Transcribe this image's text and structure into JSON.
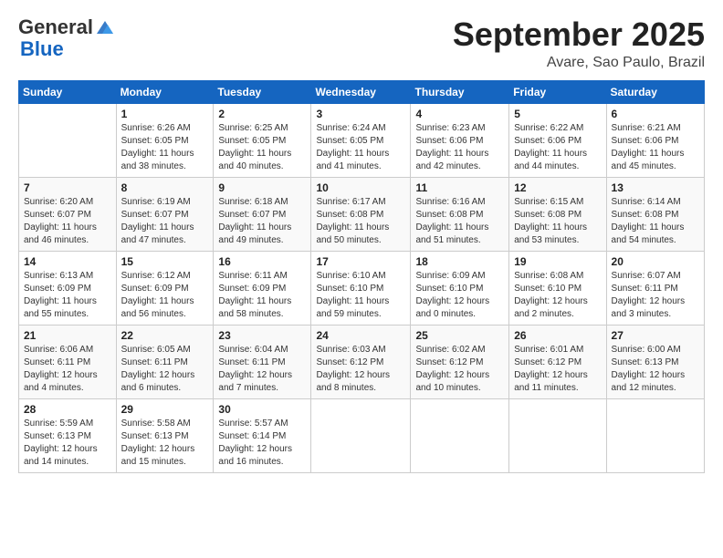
{
  "logo": {
    "general": "General",
    "blue": "Blue"
  },
  "header": {
    "month": "September 2025",
    "location": "Avare, Sao Paulo, Brazil"
  },
  "weekdays": [
    "Sunday",
    "Monday",
    "Tuesday",
    "Wednesday",
    "Thursday",
    "Friday",
    "Saturday"
  ],
  "weeks": [
    [
      {
        "day": "",
        "info": ""
      },
      {
        "day": "1",
        "info": "Sunrise: 6:26 AM\nSunset: 6:05 PM\nDaylight: 11 hours\nand 38 minutes."
      },
      {
        "day": "2",
        "info": "Sunrise: 6:25 AM\nSunset: 6:05 PM\nDaylight: 11 hours\nand 40 minutes."
      },
      {
        "day": "3",
        "info": "Sunrise: 6:24 AM\nSunset: 6:05 PM\nDaylight: 11 hours\nand 41 minutes."
      },
      {
        "day": "4",
        "info": "Sunrise: 6:23 AM\nSunset: 6:06 PM\nDaylight: 11 hours\nand 42 minutes."
      },
      {
        "day": "5",
        "info": "Sunrise: 6:22 AM\nSunset: 6:06 PM\nDaylight: 11 hours\nand 44 minutes."
      },
      {
        "day": "6",
        "info": "Sunrise: 6:21 AM\nSunset: 6:06 PM\nDaylight: 11 hours\nand 45 minutes."
      }
    ],
    [
      {
        "day": "7",
        "info": "Sunrise: 6:20 AM\nSunset: 6:07 PM\nDaylight: 11 hours\nand 46 minutes."
      },
      {
        "day": "8",
        "info": "Sunrise: 6:19 AM\nSunset: 6:07 PM\nDaylight: 11 hours\nand 47 minutes."
      },
      {
        "day": "9",
        "info": "Sunrise: 6:18 AM\nSunset: 6:07 PM\nDaylight: 11 hours\nand 49 minutes."
      },
      {
        "day": "10",
        "info": "Sunrise: 6:17 AM\nSunset: 6:08 PM\nDaylight: 11 hours\nand 50 minutes."
      },
      {
        "day": "11",
        "info": "Sunrise: 6:16 AM\nSunset: 6:08 PM\nDaylight: 11 hours\nand 51 minutes."
      },
      {
        "day": "12",
        "info": "Sunrise: 6:15 AM\nSunset: 6:08 PM\nDaylight: 11 hours\nand 53 minutes."
      },
      {
        "day": "13",
        "info": "Sunrise: 6:14 AM\nSunset: 6:08 PM\nDaylight: 11 hours\nand 54 minutes."
      }
    ],
    [
      {
        "day": "14",
        "info": "Sunrise: 6:13 AM\nSunset: 6:09 PM\nDaylight: 11 hours\nand 55 minutes."
      },
      {
        "day": "15",
        "info": "Sunrise: 6:12 AM\nSunset: 6:09 PM\nDaylight: 11 hours\nand 56 minutes."
      },
      {
        "day": "16",
        "info": "Sunrise: 6:11 AM\nSunset: 6:09 PM\nDaylight: 11 hours\nand 58 minutes."
      },
      {
        "day": "17",
        "info": "Sunrise: 6:10 AM\nSunset: 6:10 PM\nDaylight: 11 hours\nand 59 minutes."
      },
      {
        "day": "18",
        "info": "Sunrise: 6:09 AM\nSunset: 6:10 PM\nDaylight: 12 hours\nand 0 minutes."
      },
      {
        "day": "19",
        "info": "Sunrise: 6:08 AM\nSunset: 6:10 PM\nDaylight: 12 hours\nand 2 minutes."
      },
      {
        "day": "20",
        "info": "Sunrise: 6:07 AM\nSunset: 6:11 PM\nDaylight: 12 hours\nand 3 minutes."
      }
    ],
    [
      {
        "day": "21",
        "info": "Sunrise: 6:06 AM\nSunset: 6:11 PM\nDaylight: 12 hours\nand 4 minutes."
      },
      {
        "day": "22",
        "info": "Sunrise: 6:05 AM\nSunset: 6:11 PM\nDaylight: 12 hours\nand 6 minutes."
      },
      {
        "day": "23",
        "info": "Sunrise: 6:04 AM\nSunset: 6:11 PM\nDaylight: 12 hours\nand 7 minutes."
      },
      {
        "day": "24",
        "info": "Sunrise: 6:03 AM\nSunset: 6:12 PM\nDaylight: 12 hours\nand 8 minutes."
      },
      {
        "day": "25",
        "info": "Sunrise: 6:02 AM\nSunset: 6:12 PM\nDaylight: 12 hours\nand 10 minutes."
      },
      {
        "day": "26",
        "info": "Sunrise: 6:01 AM\nSunset: 6:12 PM\nDaylight: 12 hours\nand 11 minutes."
      },
      {
        "day": "27",
        "info": "Sunrise: 6:00 AM\nSunset: 6:13 PM\nDaylight: 12 hours\nand 12 minutes."
      }
    ],
    [
      {
        "day": "28",
        "info": "Sunrise: 5:59 AM\nSunset: 6:13 PM\nDaylight: 12 hours\nand 14 minutes."
      },
      {
        "day": "29",
        "info": "Sunrise: 5:58 AM\nSunset: 6:13 PM\nDaylight: 12 hours\nand 15 minutes."
      },
      {
        "day": "30",
        "info": "Sunrise: 5:57 AM\nSunset: 6:14 PM\nDaylight: 12 hours\nand 16 minutes."
      },
      {
        "day": "",
        "info": ""
      },
      {
        "day": "",
        "info": ""
      },
      {
        "day": "",
        "info": ""
      },
      {
        "day": "",
        "info": ""
      }
    ]
  ]
}
